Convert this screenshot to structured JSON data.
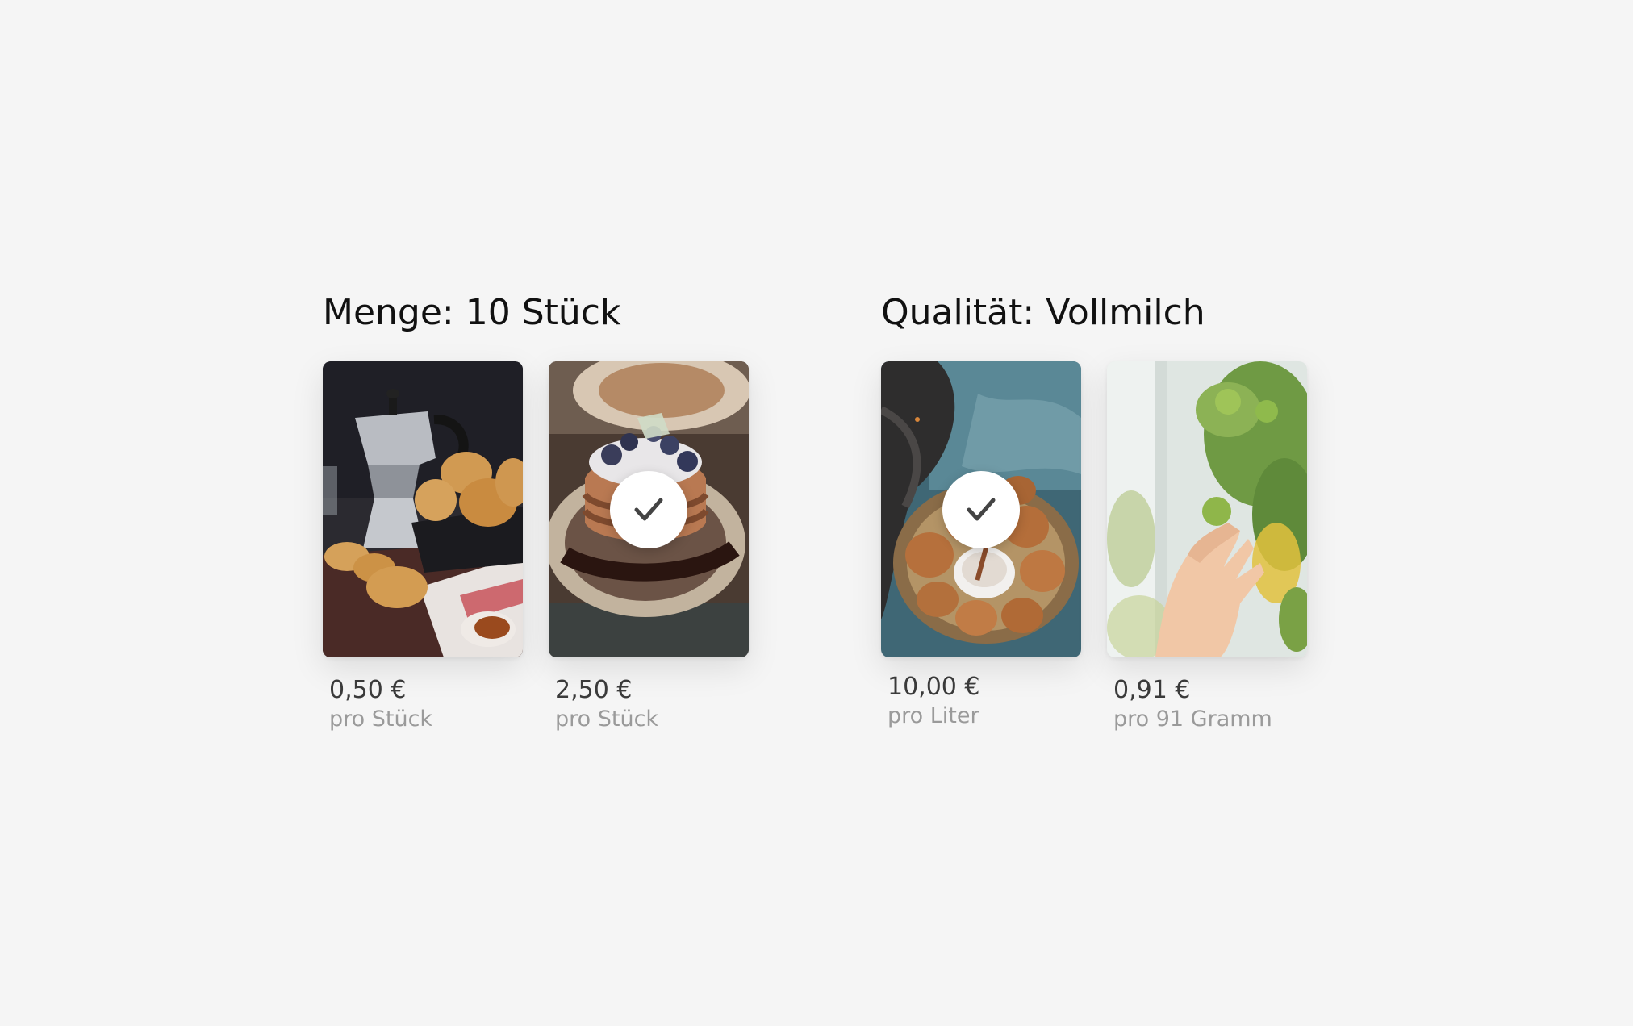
{
  "groups": [
    {
      "title": "Menge: 10 Stück",
      "options": [
        {
          "image": "cookies-and-moka-pot-photo",
          "price": "0,50 €",
          "unit": "pro Stück",
          "selected": false
        },
        {
          "image": "blueberry-pancakes-photo",
          "price": "2,50 €",
          "unit": "pro Stück",
          "selected": true
        }
      ]
    },
    {
      "title": "Qualität: Vollmilch",
      "options": [
        {
          "image": "cookies-plate-photo",
          "price": "10,00 €",
          "unit": "pro Liter",
          "selected": true
        },
        {
          "image": "hand-picking-lime-photo",
          "price": "0,91 €",
          "unit": "pro 91 Gramm",
          "selected": false
        }
      ]
    }
  ],
  "icons": {
    "selected": "checkmark-icon"
  },
  "colors": {
    "background": "#f5f5f5",
    "title": "#111111",
    "price": "#3b3b3b",
    "unit": "#9a9a9a",
    "check_circle": "#ffffff",
    "check_mark": "#444444"
  }
}
